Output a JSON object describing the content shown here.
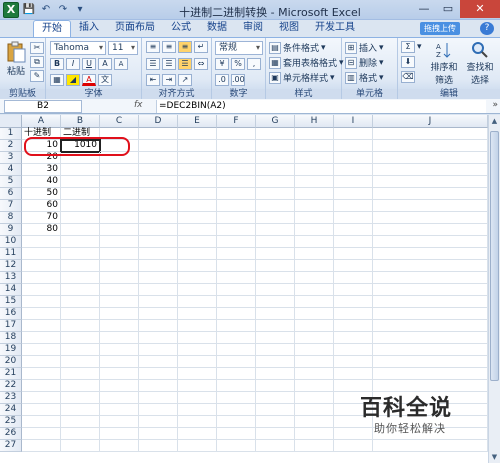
{
  "window": {
    "title": "十进制二进制转换 - Microsoft Excel",
    "app_icon": "X",
    "controls": [
      "—",
      "▭",
      "✕"
    ]
  },
  "quick_access": [
    "💾",
    "↶",
    "↷",
    "▾"
  ],
  "tabs": [
    "开始",
    "插入",
    "页面布局",
    "公式",
    "数据",
    "审阅",
    "视图",
    "开发工具"
  ],
  "upload_label": "拖拽上传",
  "ribbon": {
    "clipboard": {
      "paste": "粘贴",
      "label": "剪贴板"
    },
    "font": {
      "name": "Tahoma",
      "size": "11",
      "label": "字体",
      "grow": "A",
      "shrink": "A"
    },
    "alignment": {
      "label": "对齐方式"
    },
    "number": {
      "format": "常规",
      "label": "数字"
    },
    "styles": {
      "conditional": "条件格式",
      "table": "套用表格格式",
      "cell": "单元格样式",
      "label": "样式"
    },
    "cells": {
      "insert": "插入",
      "delete": "删除",
      "format": "格式",
      "label": "单元格"
    },
    "editing": {
      "sort": "排序和筛选",
      "find": "查找和选择",
      "sum": "Σ",
      "label": "编辑"
    }
  },
  "formula_bar": {
    "name_box": "B2",
    "fx": "fx",
    "formula": "=DEC2BIN(A2)"
  },
  "sheet": {
    "columns": [
      "A",
      "B",
      "C",
      "D",
      "E",
      "F",
      "G",
      "H",
      "I",
      "J"
    ],
    "rows": [
      "1",
      "2",
      "3",
      "4",
      "5",
      "6",
      "7",
      "8",
      "9",
      "10",
      "11",
      "12",
      "13",
      "14",
      "15",
      "16",
      "17",
      "18",
      "19",
      "20",
      "21",
      "22",
      "23",
      "24",
      "25",
      "26",
      "27"
    ],
    "header_a": "十进制",
    "header_b": "二进制",
    "values_a": [
      "10",
      "20",
      "30",
      "40",
      "50",
      "60",
      "70",
      "80"
    ],
    "b2": "1010",
    "selected_cell": "B2"
  },
  "watermark": {
    "title": "百科全说",
    "subtitle": "助你轻松解决"
  }
}
